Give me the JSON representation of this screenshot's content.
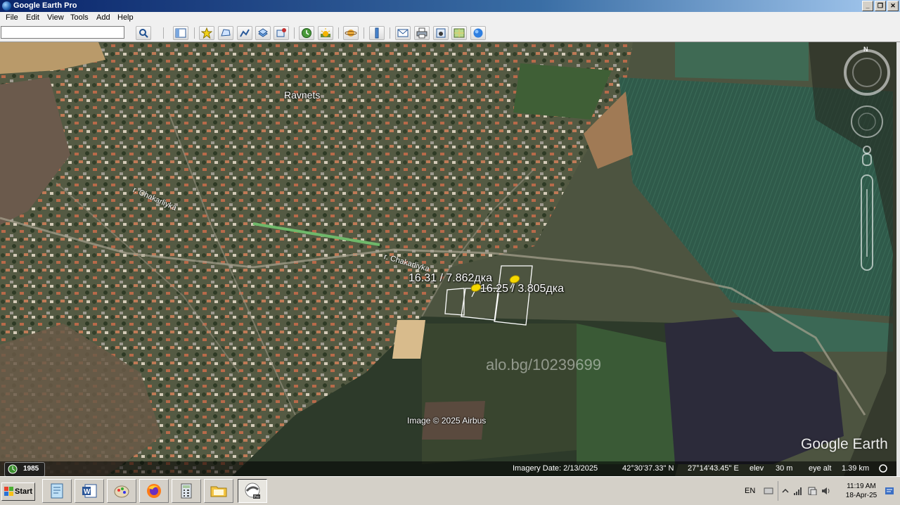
{
  "window": {
    "title": "Google Earth Pro"
  },
  "menu": {
    "items": [
      "File",
      "Edit",
      "View",
      "Tools",
      "Add",
      "Help"
    ]
  },
  "toolbar": {
    "search_value": "",
    "buttons": [
      "search-icon",
      "sidebar-icon",
      "placemark-icon",
      "polygon-icon",
      "path-icon",
      "overlay-icon",
      "tour-icon",
      "historical-imagery-icon",
      "sunlight-icon",
      "planets-icon",
      "ruler-icon",
      "email-icon",
      "print-icon",
      "save-image-icon",
      "map-view-icon",
      "maps-globe-icon"
    ]
  },
  "map": {
    "town_label": "Ravnets",
    "river_label_1": "r. Chakarliyka",
    "river_label_2": "r. Chakarliyka",
    "parcel_label_1": "16.31 / 7.862дка",
    "parcel_label_2": "16.25 / 3.805дка",
    "watermark": "alo.bg/10239699",
    "image_credit": "Image © 2025 Airbus",
    "logo": "Google Earth",
    "compass_north": "N",
    "historical_year": "1985"
  },
  "status": {
    "imagery_date": "Imagery Date: 2/13/2025",
    "lat": "42°30'37.33\" N",
    "lon": "27°14'43.45\" E",
    "elev_label": "elev",
    "elev_value": "30 m",
    "eye_label": "eye alt",
    "eye_value": "1.39 km"
  },
  "taskbar": {
    "start_label": "Start",
    "apps": [
      "notepad-icon",
      "word-icon",
      "paint-icon",
      "firefox-icon",
      "calculator-icon",
      "explorer-icon",
      "google-earth-pro-icon"
    ],
    "lang": "EN",
    "time": "11:19 AM",
    "date": "18-Apr-25"
  },
  "colors": {
    "titlebar_start": "#0a246a",
    "pin_yellow": "#f5d800",
    "parcel_outline": "#ffffff"
  }
}
